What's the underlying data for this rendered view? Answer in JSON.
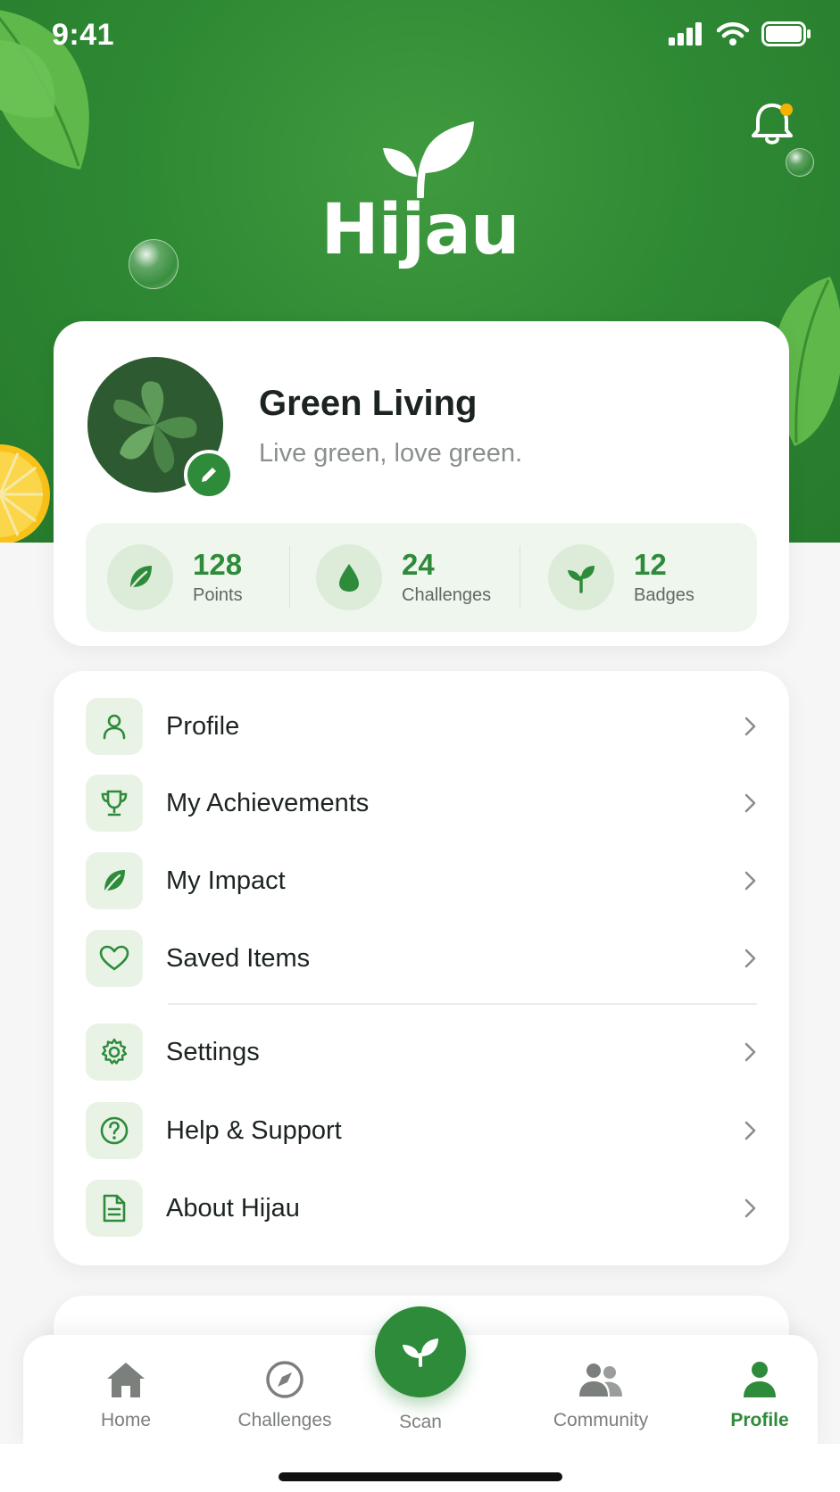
{
  "status_bar": {
    "time": "9:41"
  },
  "app": {
    "name": "Hijau"
  },
  "profile": {
    "name": "Green Living",
    "tagline": "Live green, love green."
  },
  "stats": [
    {
      "value": "128",
      "label": "Points",
      "icon": "leaf-icon"
    },
    {
      "value": "24",
      "label": "Challenges",
      "icon": "water-drop-icon"
    },
    {
      "value": "12",
      "label": "Badges",
      "icon": "sprout-icon"
    }
  ],
  "menu": [
    {
      "label": "Profile",
      "icon": "user-icon"
    },
    {
      "label": "My Achievements",
      "icon": "trophy-icon"
    },
    {
      "label": "My Impact",
      "icon": "leaf-icon"
    },
    {
      "label": "Saved Items",
      "icon": "heart-icon"
    },
    {
      "label": "Settings",
      "icon": "gear-icon"
    },
    {
      "label": "Help & Support",
      "icon": "help-circle-icon"
    },
    {
      "label": "About Hijau",
      "icon": "document-icon"
    }
  ],
  "tabs": [
    {
      "label": "Home",
      "icon": "home-icon"
    },
    {
      "label": "Challenges",
      "icon": "compass-icon"
    },
    {
      "label": "Scan",
      "icon": "sprout-icon"
    },
    {
      "label": "Community",
      "icon": "people-icon"
    },
    {
      "label": "Profile",
      "icon": "person-icon",
      "active": true
    }
  ],
  "colors": {
    "primary": "#2e8b3a",
    "hero": "#2f8a34",
    "notification_dot": "#f5b301"
  }
}
